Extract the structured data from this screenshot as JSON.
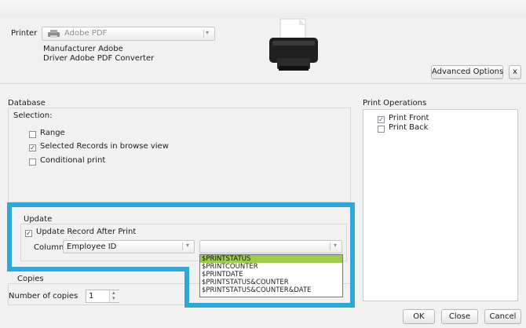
{
  "printer": {
    "label": "Printer",
    "selected": "Adobe PDF",
    "manufacturer_line": "Manufacturer Adobe",
    "driver_line": "Driver Adobe PDF Converter"
  },
  "toolbar": {
    "advanced_options": "Advanced Options",
    "close_x": "x"
  },
  "database": {
    "title": "Database",
    "selection_label": "Selection:",
    "options": [
      {
        "label": "Range",
        "checked": false
      },
      {
        "label": "Selected Records in browse view",
        "checked": true
      },
      {
        "label": "Conditional print",
        "checked": false
      }
    ]
  },
  "print_operations": {
    "title": "Print Operations",
    "items": [
      {
        "label": "Print Front",
        "checked": true
      },
      {
        "label": "Print Back",
        "checked": false
      }
    ]
  },
  "update": {
    "title": "Update",
    "update_after_print_label": "Update Record After Print",
    "update_after_print_checked": true,
    "column_label": "Column",
    "column_value": "Employee ID",
    "value_field": "",
    "value_options": [
      "$PRINTSTATUS",
      "$PRINTCOUNTER",
      "$PRINTDATE",
      "$PRINTSTATUS&COUNTER",
      "$PRINTSTATUS&COUNTER&DATE"
    ],
    "selected_option_index": 0
  },
  "copies": {
    "title": "Copies",
    "number_label": "Number of copies",
    "value": "1"
  },
  "footer": {
    "ok": "OK",
    "close": "Close",
    "cancel": "Cancel"
  },
  "colors": {
    "highlight": "#2ea8d8",
    "selected_option": "#9dcd4a"
  }
}
